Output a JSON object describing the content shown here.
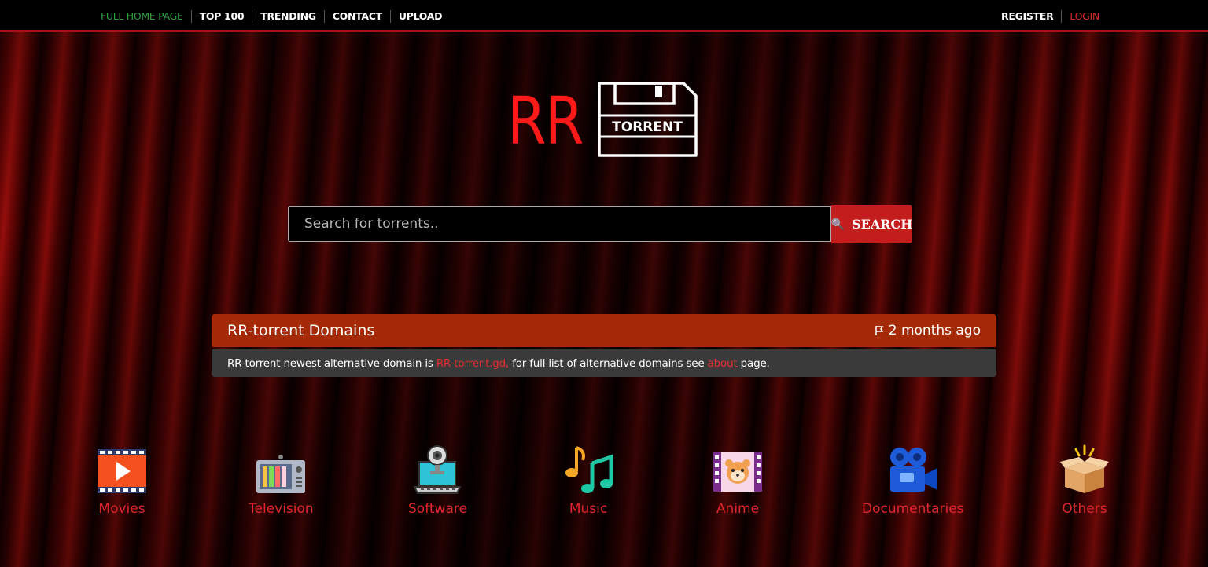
{
  "nav": {
    "left": [
      {
        "label": "FULL HOME PAGE"
      },
      {
        "label": "TOP 100"
      },
      {
        "label": "TRENDING"
      },
      {
        "label": "CONTACT"
      },
      {
        "label": "UPLOAD"
      }
    ],
    "right": [
      {
        "label": "REGISTER"
      },
      {
        "label": "LOGIN"
      }
    ]
  },
  "logo": {
    "rr": "RR",
    "disk_text": "TORRENT"
  },
  "search": {
    "placeholder": "Search for torrents..",
    "button_label": "SEARCH",
    "button_icon": "magnifier-icon"
  },
  "announcement": {
    "title": "RR-torrent Domains",
    "time": "2 months ago",
    "time_icon": "flag-icon",
    "body_prefix": "RR-torrent newest alternative domain is ",
    "domain_link": "RR-torrent.gd,",
    "body_middle": " for full list of alternative domains see ",
    "about_link": "about",
    "body_suffix": " page."
  },
  "categories": [
    {
      "label": "Movies",
      "icon": "movie-film-icon"
    },
    {
      "label": "Television",
      "icon": "tv-icon"
    },
    {
      "label": "Software",
      "icon": "laptop-webcam-icon"
    },
    {
      "label": "Music",
      "icon": "music-notes-icon"
    },
    {
      "label": "Anime",
      "icon": "anime-film-icon"
    },
    {
      "label": "Documentaries",
      "icon": "video-camera-icon"
    },
    {
      "label": "Others",
      "icon": "open-box-icon"
    }
  ],
  "colors": {
    "accent": "#c31d1d",
    "green_link": "#2ea043",
    "announce_head": "#a52a08",
    "category_text": "#e0262a"
  }
}
